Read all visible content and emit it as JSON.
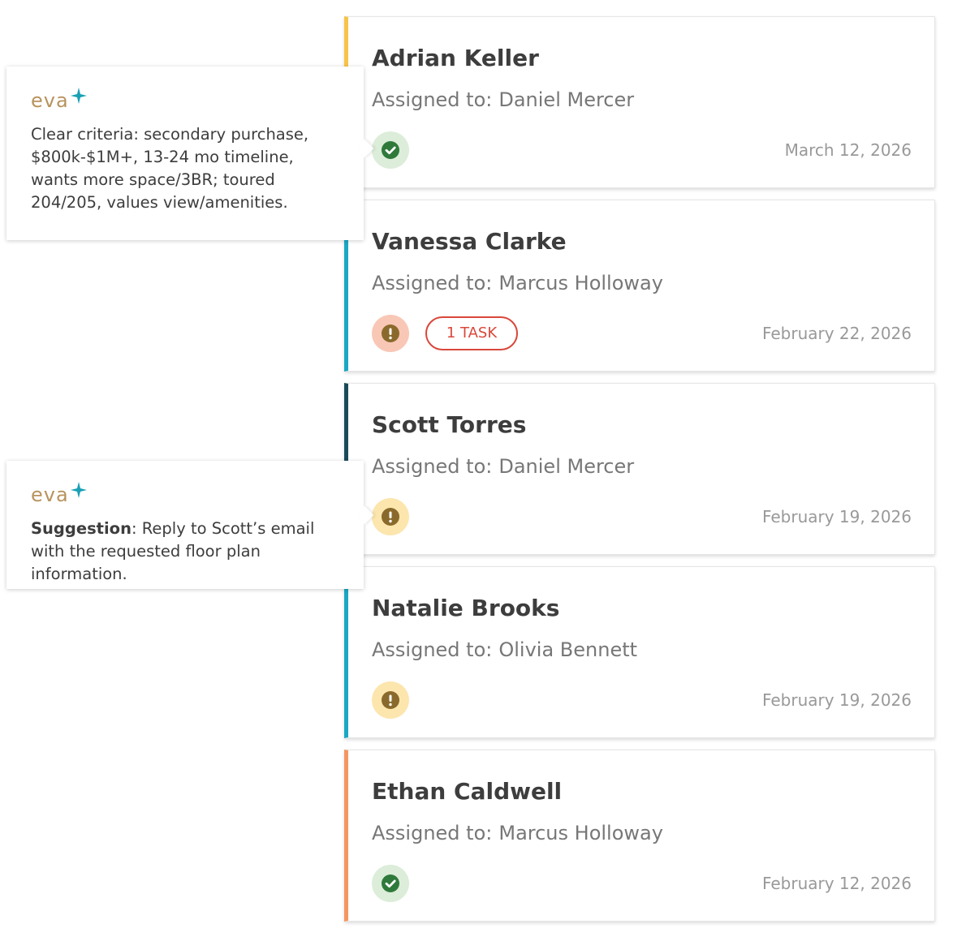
{
  "accent_colors": {
    "yellow": "#f7c44a",
    "teal": "#1aa8c4",
    "dark_teal": "#1a4a5a",
    "orange": "#f5965f",
    "eva_gold": "#b8935c",
    "eva_spark": "#1aa0b5",
    "task_red": "#d9473b"
  },
  "assigned_label": "Assigned to:",
  "cards": [
    {
      "name": "Adrian Keller",
      "assignee": "Daniel Mercer",
      "status_icon": "check-circle-icon",
      "date": "March 12, 2026"
    },
    {
      "name": "Vanessa Clarke",
      "assignee": "Marcus Holloway",
      "status_icon": "exclamation-circle-icon",
      "task_badge": "1 TASK",
      "date": "February 22, 2026"
    },
    {
      "name": "Scott Torres",
      "assignee": "Daniel Mercer",
      "status_icon": "exclamation-circle-icon",
      "date": "February 19, 2026"
    },
    {
      "name": "Natalie Brooks",
      "assignee": "Olivia Bennett",
      "status_icon": "exclamation-circle-icon",
      "date": "February 19, 2026"
    },
    {
      "name": "Ethan Caldwell",
      "assignee": "Marcus Holloway",
      "status_icon": "check-circle-icon",
      "date": "February 12, 2026"
    }
  ],
  "tooltips": [
    {
      "brand": "eva",
      "brand_icon": "sparkle-icon",
      "text": "Clear criteria: secondary purchase, $800k-$1M+, 13-24 mo timeline, wants more space/3BR; toured 204/205, values view/amenities."
    },
    {
      "brand": "eva",
      "brand_icon": "sparkle-icon",
      "label": "Suggestion",
      "text": ": Reply to Scott’s email with the requested floor plan information."
    }
  ]
}
